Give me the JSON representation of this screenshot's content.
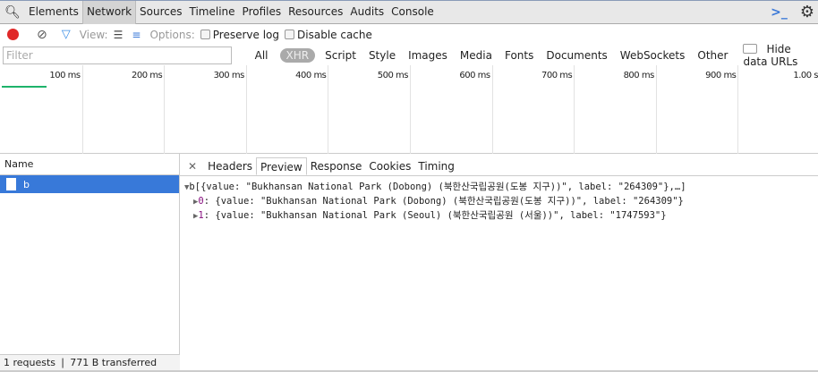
{
  "tabs": [
    "Elements",
    "Network",
    "Sources",
    "Timeline",
    "Profiles",
    "Resources",
    "Audits",
    "Console"
  ],
  "selected_tab": "Network",
  "toolbar": {
    "view_label": "View:",
    "options_label": "Options:",
    "preserve_log": "Preserve log",
    "disable_cache": "Disable cache"
  },
  "filter": {
    "placeholder": "Filter",
    "types": [
      "All",
      "XHR",
      "Script",
      "Style",
      "Images",
      "Media",
      "Fonts",
      "Documents",
      "WebSockets",
      "Other"
    ],
    "selected": "XHR",
    "hide_data_urls": "Hide data URLs"
  },
  "timeline": {
    "ticks": [
      "100 ms",
      "200 ms",
      "300 ms",
      "400 ms",
      "500 ms",
      "600 ms",
      "700 ms",
      "800 ms",
      "900 ms",
      "1.00 s"
    ]
  },
  "requests": {
    "header": "Name",
    "items": [
      "b"
    ]
  },
  "detail_tabs": [
    "Headers",
    "Preview",
    "Response",
    "Cookies",
    "Timing"
  ],
  "selected_detail_tab": "Preview",
  "preview": {
    "root": "b[{value: \"Bukhansan National Park (Dobong) (북한산국립공원(도봉 지구))\", label: \"264309\"},…]",
    "items": [
      {
        "index": "0",
        "text": ": {value: \"Bukhansan National Park (Dobong) (북한산국립공원(도봉 지구))\", label: \"264309\"}"
      },
      {
        "index": "1",
        "text": ": {value: \"Bukhansan National Park (Seoul) (북한산국립공원 (서울))\", label: \"1747593\"}"
      }
    ]
  },
  "footer": "1 requests  ❘  771 B transferred",
  "colors": {
    "selected_row": "#3879d9",
    "record": "#e02828",
    "accent": "#1a73e8"
  }
}
